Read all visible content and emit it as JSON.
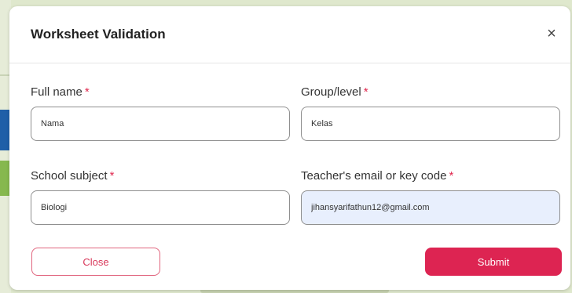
{
  "modal": {
    "title": "Worksheet Validation",
    "close_icon": "×"
  },
  "form": {
    "full_name": {
      "label": "Full name",
      "required": "*",
      "value": "Nama"
    },
    "group_level": {
      "label": "Group/level",
      "required": "*",
      "value": "Kelas"
    },
    "school_subject": {
      "label": "School subject",
      "required": "*",
      "value": "Biologi"
    },
    "teacher_email": {
      "label": "Teacher's email or key code",
      "required": "*",
      "value": "jihansyarifathun12@gmail.com"
    }
  },
  "buttons": {
    "close_label": "Close",
    "submit_label": "Submit"
  },
  "colors": {
    "accent": "#dd2452",
    "required": "#e0294f",
    "autofill_bg": "#e8effd"
  }
}
